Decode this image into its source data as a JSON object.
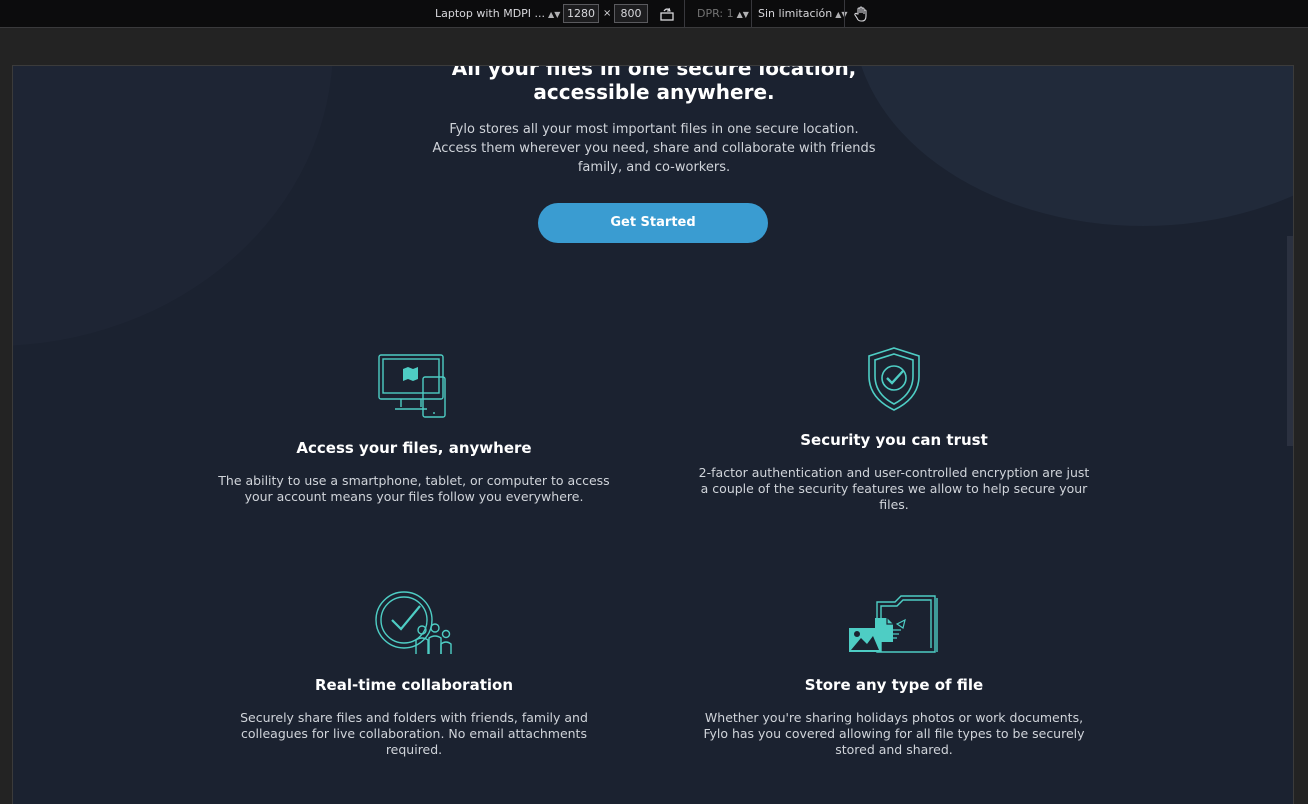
{
  "toolbar": {
    "device": "Laptop with MDPI ...",
    "width": "1280",
    "times": "×",
    "height": "800",
    "dpr": "DPR: 1",
    "throttle": "Sin limitación"
  },
  "hero": {
    "title_line1": "All your files in one secure location,",
    "title_line2": "accessible anywhere.",
    "desc_line1": "Fylo stores all your most important files in one secure location.",
    "desc_line2": "Access them wherever you need, share and collaborate with friends",
    "desc_line3": "family, and co-workers.",
    "cta_label": "Get Started"
  },
  "features": [
    {
      "title": "Access your files, anywhere",
      "desc_line1": "The ability to use a smartphone, tablet, or computer to access",
      "desc_line2": "your account means your files follow you everywhere.",
      "icon": "devices-icon"
    },
    {
      "title": "Security you can trust",
      "desc_line1": "2-factor authentication and user-controlled encryption are just",
      "desc_line2": "a couple of the security features we allow to help secure your",
      "desc_line3": "files.",
      "icon": "shield-check-icon"
    },
    {
      "title": "Real-time collaboration",
      "desc_line1": "Securely share files and folders with friends, family and",
      "desc_line2": "colleagues for live collaboration. No email attachments",
      "desc_line3": "required.",
      "icon": "collaboration-icon"
    },
    {
      "title": "Store any type of file",
      "desc_line1": "Whether you're sharing holidays photos or work documents,",
      "desc_line2": "Fylo has you covered allowing for all file types to be securely",
      "desc_line3": "stored and shared.",
      "icon": "file-types-icon"
    }
  ],
  "colors": {
    "accent": "#3a9cd1",
    "icon": "#4ecdc4",
    "background": "#1b2230"
  }
}
